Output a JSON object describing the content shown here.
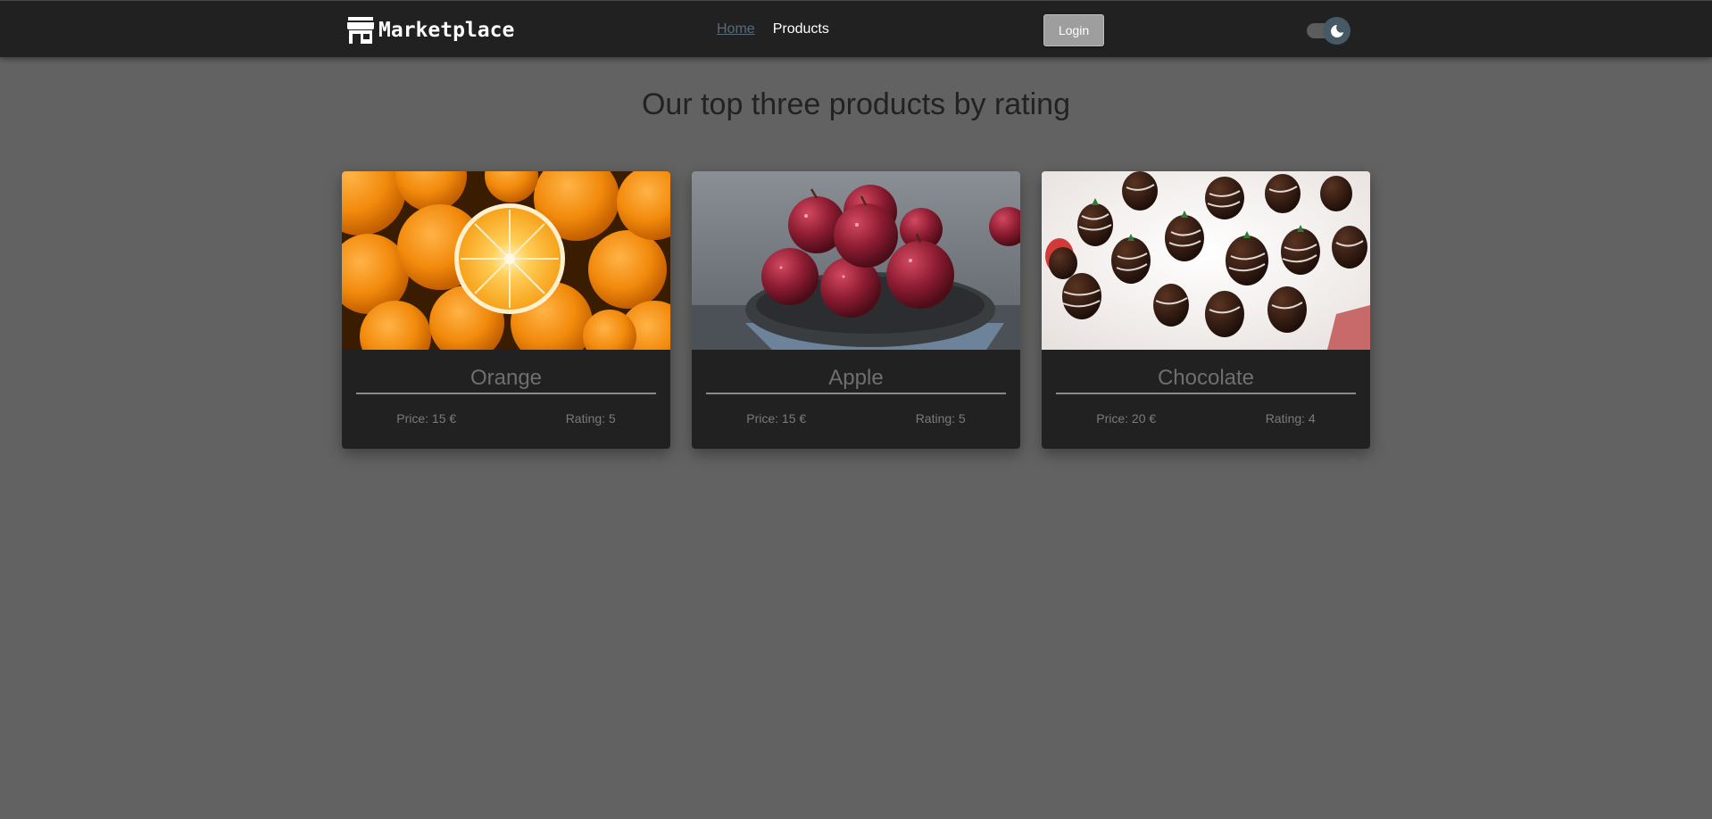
{
  "navbar": {
    "brand": "Marketplace",
    "links": [
      {
        "label": "Home",
        "active": true
      },
      {
        "label": "Products",
        "active": false
      }
    ],
    "login_label": "Login",
    "theme_toggle": {
      "state": "dark",
      "icon": "moon-icon"
    }
  },
  "main": {
    "title": "Our top three products by rating",
    "products": [
      {
        "name": "Orange",
        "price": "Price: 15 €",
        "rating": "Rating: 5",
        "image": "oranges-photo"
      },
      {
        "name": "Apple",
        "price": "Price: 15 €",
        "rating": "Rating: 5",
        "image": "apples-photo"
      },
      {
        "name": "Chocolate",
        "price": "Price: 20 €",
        "rating": "Rating: 4",
        "image": "chocolate-strawberries-photo"
      }
    ]
  },
  "colors": {
    "page_bg": "#626262",
    "navbar_bg": "#212121",
    "card_bg": "#212121",
    "login_bg": "#9e9e9e",
    "toggle_knob": "#455a64"
  }
}
